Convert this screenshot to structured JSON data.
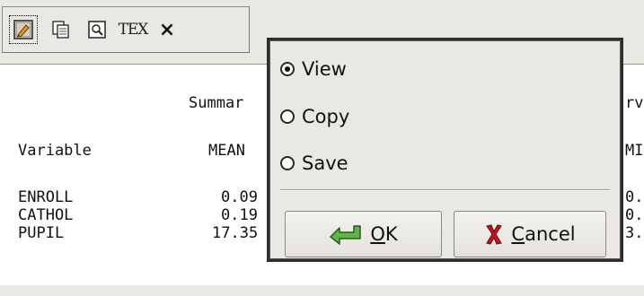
{
  "toolbar": {
    "buttons": [
      {
        "name": "notes-icon"
      },
      {
        "name": "copy-icon"
      },
      {
        "name": "preview-icon"
      },
      {
        "name": "tex-button",
        "label": "TEX"
      },
      {
        "name": "close-button",
        "label": "×"
      }
    ]
  },
  "output": {
    "header_line1": [
      "Summar",
      "rv"
    ],
    "header_line2": [
      "Variable",
      "MEAN",
      "MI"
    ],
    "rows": [
      {
        "variable": "ENROLL",
        "mean": "0.09",
        "right": "0."
      },
      {
        "variable": "CATHOL",
        "mean": "0.19",
        "right": "0."
      },
      {
        "variable": "PUPIL",
        "mean": "17.35",
        "right": "3."
      }
    ]
  },
  "dialog": {
    "options": [
      {
        "label": "View",
        "checked": true
      },
      {
        "label": "Copy",
        "checked": false
      },
      {
        "label": "Save",
        "checked": false
      }
    ],
    "ok_label_first": "O",
    "ok_label_rest": "K",
    "cancel_label_first": "C",
    "cancel_label_rest": "ancel"
  },
  "colors": {
    "window_bg": "#eae8e3",
    "dialog_border": "#2f2f2f",
    "cancel_icon": "#b8141b",
    "ok_icon": "#3f8f2e"
  }
}
